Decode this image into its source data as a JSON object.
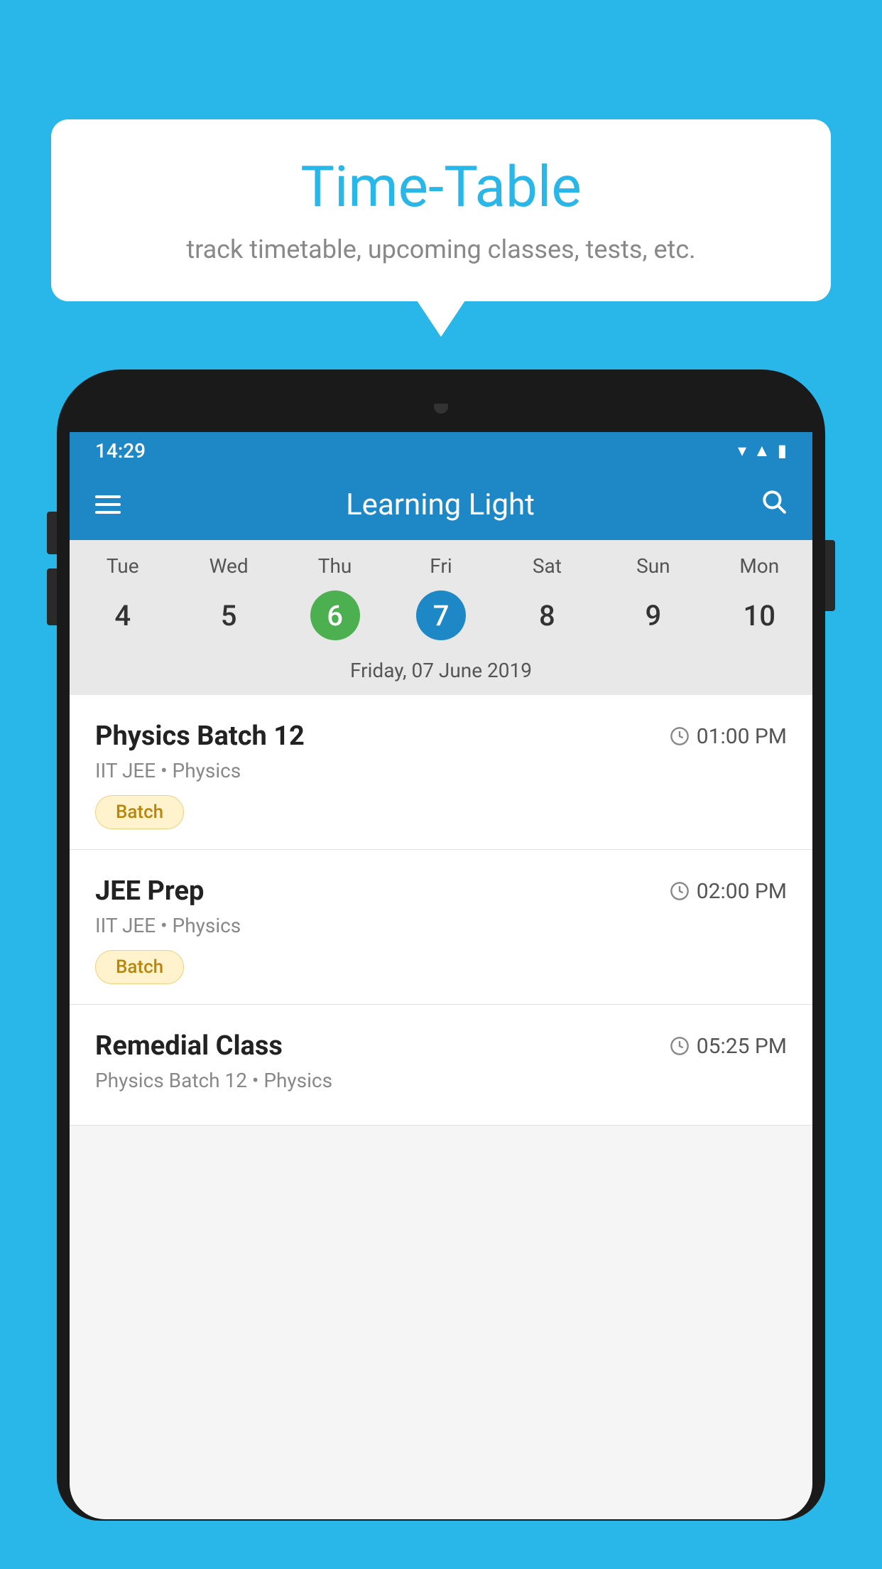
{
  "background_color": "#29b6e8",
  "bubble": {
    "title": "Time-Table",
    "subtitle": "track timetable, upcoming classes, tests, etc."
  },
  "phone": {
    "status_bar": {
      "time": "14:29"
    },
    "app_bar": {
      "title": "Learning Light"
    },
    "calendar": {
      "days": [
        "Tue",
        "Wed",
        "Thu",
        "Fri",
        "Sat",
        "Sun",
        "Mon"
      ],
      "dates": [
        "4",
        "5",
        "6",
        "7",
        "8",
        "9",
        "10"
      ],
      "today_index": 2,
      "selected_index": 3,
      "selected_date_label": "Friday, 07 June 2019"
    },
    "classes": [
      {
        "name": "Physics Batch 12",
        "time": "01:00 PM",
        "subject": "IIT JEE • Physics",
        "badge": "Batch"
      },
      {
        "name": "JEE Prep",
        "time": "02:00 PM",
        "subject": "IIT JEE • Physics",
        "badge": "Batch"
      },
      {
        "name": "Remedial Class",
        "time": "05:25 PM",
        "subject": "Physics Batch 12 • Physics",
        "badge": ""
      }
    ]
  }
}
